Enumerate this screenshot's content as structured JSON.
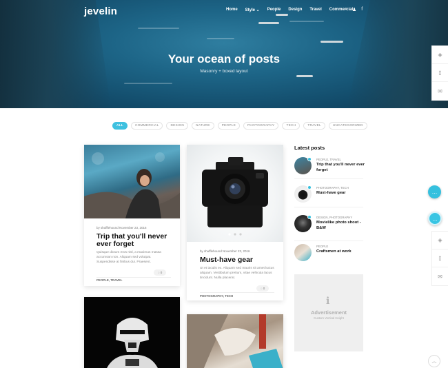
{
  "header": {
    "logo": "jevelin",
    "nav": [
      "Home",
      "Style ⌄",
      "People",
      "Design",
      "Travel",
      "Commercial"
    ],
    "icons": [
      "search-icon",
      "twitter-icon",
      "facebook-icon"
    ]
  },
  "hero": {
    "title": "Your ocean of posts",
    "subtitle": "Masonry + boxed layout"
  },
  "filters": [
    "ALL",
    "COMMERCIAL",
    "DESIGN",
    "NATURE",
    "PEOPLE",
    "PHOTOGRAPHY",
    "TECH",
    "TRAVEL",
    "UNCATEGORIZED"
  ],
  "posts": [
    {
      "meta": "by shufflehound     November 23, 2016",
      "title": "Trip that you'll never ever forget",
      "excerpt": "Quisque dictum eros nisl, a maximus massa accumsan non. Aliquam sed volutpat. Suspendisse at finibus dui. Praesent.",
      "comments": "0",
      "categories": "PEOPLE, TRAVEL"
    },
    {
      "meta": "by shufflehound     November 23, 2016",
      "title": "Must-have gear",
      "excerpt": "Ut et iaculis ex. Aliquam sed mauris sit amet luctus aliquam. Vestibulum pretium, vitae vehicula lacus tincidunt. Nulla placerat.",
      "comments": "0",
      "categories": "PHOTOGRAPHY, TECH"
    }
  ],
  "sidebar": {
    "latest_title": "Latest posts",
    "latest": [
      {
        "category": "PEOPLE, TRAVEL",
        "title": "Trip that you'll never ever forget"
      },
      {
        "category": "PHOTOGRAPHY, TECH",
        "title": "Must-have gear"
      },
      {
        "category": "DESIGN, PHOTOGRAPHY",
        "title": "Movielike photo shoot - B&W"
      },
      {
        "category": "PEOPLE",
        "title": "Craftsmen at work"
      }
    ],
    "ad_title": "Advertisement",
    "ad_subtitle": "Custom Vertical Height"
  },
  "colors": {
    "accent": "#3fc1e0",
    "text": "#111111"
  }
}
